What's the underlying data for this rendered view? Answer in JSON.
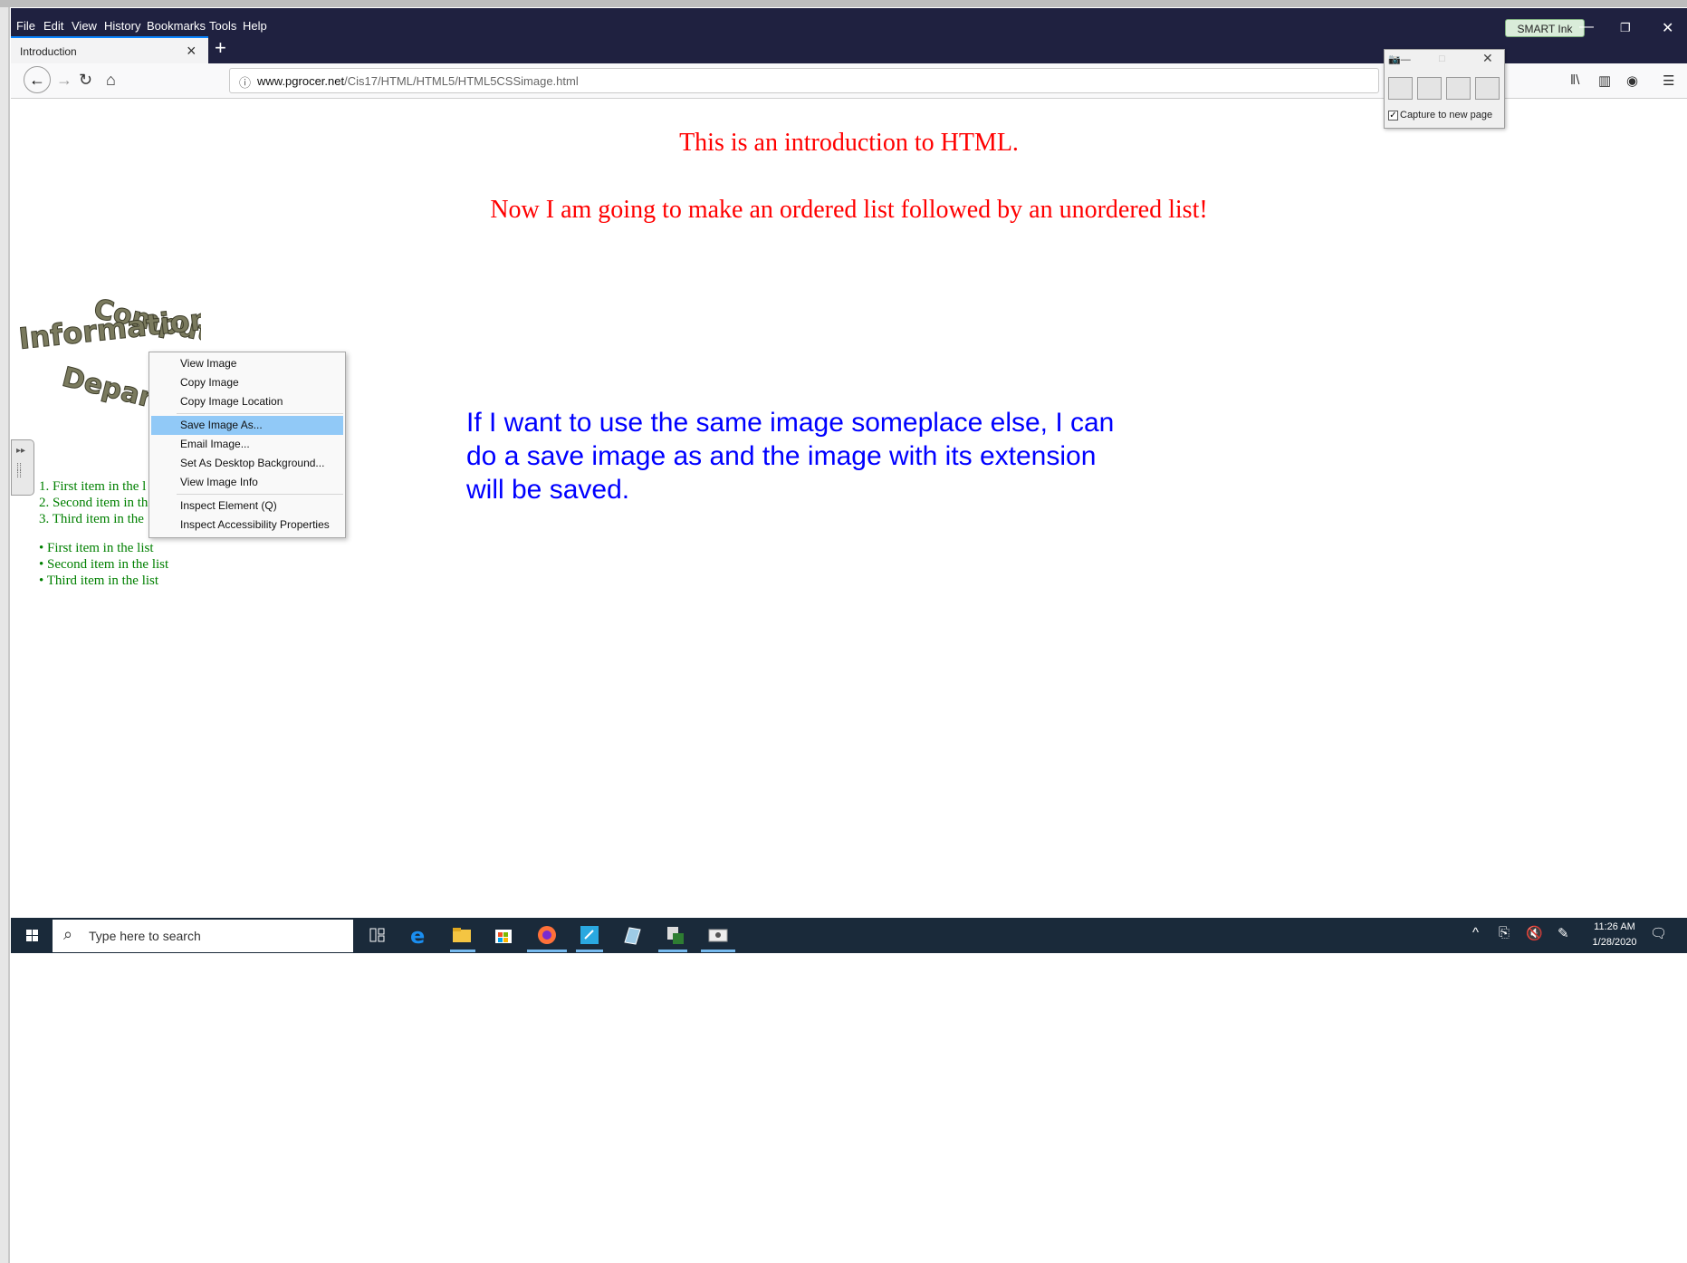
{
  "menu": [
    "File",
    "Edit",
    "View",
    "History",
    "Bookmarks",
    "Tools",
    "Help"
  ],
  "smart_ink_label": "SMART Ink",
  "tab": {
    "title": "Introduction"
  },
  "url": {
    "host": "www.pgrocer.net",
    "path": "/Cis17/HTML/HTML5/HTML5CSSimage.html"
  },
  "page": {
    "heading1": "This is an introduction to HTML.",
    "heading2": "Now I am going to make an ordered list followed by an unordered list!",
    "logo_words": [
      "Computer",
      "Information",
      "Department"
    ],
    "blue_lines": [
      "If I want to use the same image someplace else, I can",
      "do a save image as and the image with its extension",
      "will be saved."
    ],
    "ordered_list": [
      "1. First item in the l",
      "2. Second item in th",
      "3. Third item in the"
    ],
    "unordered_list": [
      "First item in the list",
      "Second item in the list",
      "Third item in the list"
    ]
  },
  "context_menu": {
    "items": [
      "View Image",
      "Copy Image",
      "Copy Image Location",
      "Save Image As...",
      "Email Image...",
      "Set As Desktop Background...",
      "View Image Info",
      "Inspect Element (Q)",
      "Inspect Accessibility Properties"
    ],
    "highlighted": "Save Image As..."
  },
  "capture_tool": {
    "checkbox_label": "Capture to new page",
    "checked": true
  },
  "taskbar": {
    "search_placeholder": "Type here to search",
    "time": "11:26 AM",
    "date": "1/28/2020"
  },
  "colors": {
    "heading": "#ff0000",
    "blue_text": "#0000ff",
    "list": "#008000",
    "titlebar": "#1f2140",
    "menu_highlight": "#91c9f7"
  }
}
